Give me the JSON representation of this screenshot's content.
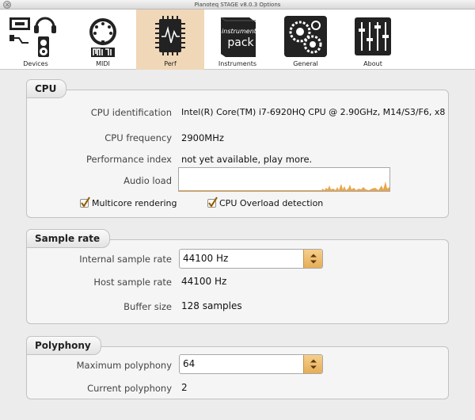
{
  "window": {
    "title": "Pianoteq STAGE v8.0.3 Options"
  },
  "toolbar": {
    "tabs": [
      {
        "label": "Devices",
        "icon": "devices-icon"
      },
      {
        "label": "MIDI",
        "icon": "midi-icon"
      },
      {
        "label": "Perf",
        "icon": "perf-chip-icon"
      },
      {
        "label": "Instruments",
        "icon": "instrument-pack-icon"
      },
      {
        "label": "General",
        "icon": "gears-icon"
      },
      {
        "label": "About",
        "icon": "mixer-sliders-icon"
      }
    ],
    "active_tab": "Perf",
    "instruments_icon_text": [
      "instrument",
      "pack"
    ]
  },
  "cpu": {
    "legend": "CPU",
    "identification_label": "CPU identification",
    "identification_value": "Intel(R) Core(TM) i7-6920HQ CPU @ 2.90GHz, M14/S3/F6, x8",
    "frequency_label": "CPU frequency",
    "frequency_value": "2900MHz",
    "perf_index_label": "Performance index",
    "perf_index_value": "not yet available, play more.",
    "audio_load_label": "Audio load",
    "multicore_label": "Multicore rendering",
    "multicore_checked": true,
    "overload_label": "CPU Overload detection",
    "overload_checked": true
  },
  "sample_rate": {
    "legend": "Sample rate",
    "internal_label": "Internal sample rate",
    "internal_value": "44100 Hz",
    "host_label": "Host sample rate",
    "host_value": "44100 Hz",
    "buffer_label": "Buffer size",
    "buffer_value": "128 samples"
  },
  "polyphony": {
    "legend": "Polyphony",
    "max_label": "Maximum polyphony",
    "max_value": "64",
    "current_label": "Current polyphony",
    "current_value": "2"
  },
  "colors": {
    "active_tab_bg": "#f0d7b7",
    "audio_load_graph": "#e8a64a",
    "select_arrow_bg": "#eab766"
  }
}
